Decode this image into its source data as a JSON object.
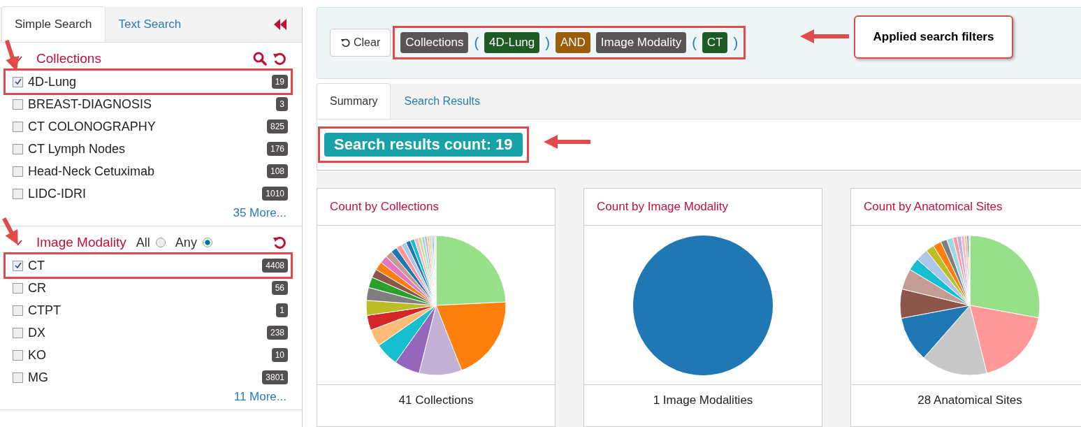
{
  "sidebar": {
    "collapse_icon": true,
    "tabs": [
      {
        "label": "Simple Search",
        "selected": true
      },
      {
        "label": "Text Search",
        "selected": false
      }
    ],
    "facets": [
      {
        "title": "Collections",
        "expanded": true,
        "search_icon": true,
        "more": "35 More...",
        "items": [
          {
            "label": "4D-Lung",
            "count": "19",
            "checked": true,
            "highlighted": true
          },
          {
            "label": "BREAST-DIAGNOSIS",
            "count": "3",
            "checked": false,
            "highlighted": false
          },
          {
            "label": "CT COLONOGRAPHY",
            "count": "825",
            "checked": false,
            "highlighted": false
          },
          {
            "label": "CT Lymph Nodes",
            "count": "176",
            "checked": false,
            "highlighted": false
          },
          {
            "label": "Head-Neck Cetuximab",
            "count": "108",
            "checked": false,
            "highlighted": false
          },
          {
            "label": "LIDC-IDRI",
            "count": "1010",
            "checked": false,
            "highlighted": false
          }
        ]
      },
      {
        "title": "Image Modality",
        "expanded": true,
        "search_icon": false,
        "more": "11 More...",
        "modes": [
          {
            "label": "All",
            "selected": false
          },
          {
            "label": "Any",
            "selected": true
          }
        ],
        "items": [
          {
            "label": "CT",
            "count": "4408",
            "checked": true,
            "highlighted": true
          },
          {
            "label": "CR",
            "count": "56",
            "checked": false,
            "highlighted": false
          },
          {
            "label": "CTPT",
            "count": "1",
            "checked": false,
            "highlighted": false
          },
          {
            "label": "DX",
            "count": "238",
            "checked": false,
            "highlighted": false
          },
          {
            "label": "KO",
            "count": "10",
            "checked": false,
            "highlighted": false
          },
          {
            "label": "MG",
            "count": "3801",
            "checked": false,
            "highlighted": false
          }
        ]
      }
    ]
  },
  "filter_bar": {
    "clear_label": "Clear",
    "highlighted": true,
    "tokens": [
      {
        "kind": "facet",
        "text": "Collections"
      },
      {
        "kind": "paren",
        "text": "("
      },
      {
        "kind": "value",
        "text": "4D-Lung"
      },
      {
        "kind": "paren",
        "text": ")"
      },
      {
        "kind": "operator",
        "text": "AND"
      },
      {
        "kind": "facet",
        "text": "Image Modality"
      },
      {
        "kind": "paren",
        "text": "("
      },
      {
        "kind": "value",
        "text": "CT"
      },
      {
        "kind": "paren",
        "text": ")"
      }
    ]
  },
  "callout": "Applied search filters",
  "main_tabs": [
    {
      "label": "Summary",
      "selected": true
    },
    {
      "label": "Search Results",
      "selected": false
    }
  ],
  "results_count": {
    "text": "Search results count: 19",
    "highlighted": true
  },
  "charts": [
    {
      "title": "Count by Collections",
      "footer": "41 Collections"
    },
    {
      "title": "Count by Image Modality",
      "footer": "1 Image Modalities"
    },
    {
      "title": "Count by Anatomical Sites",
      "footer": "28 Anatomical Sites"
    }
  ]
}
